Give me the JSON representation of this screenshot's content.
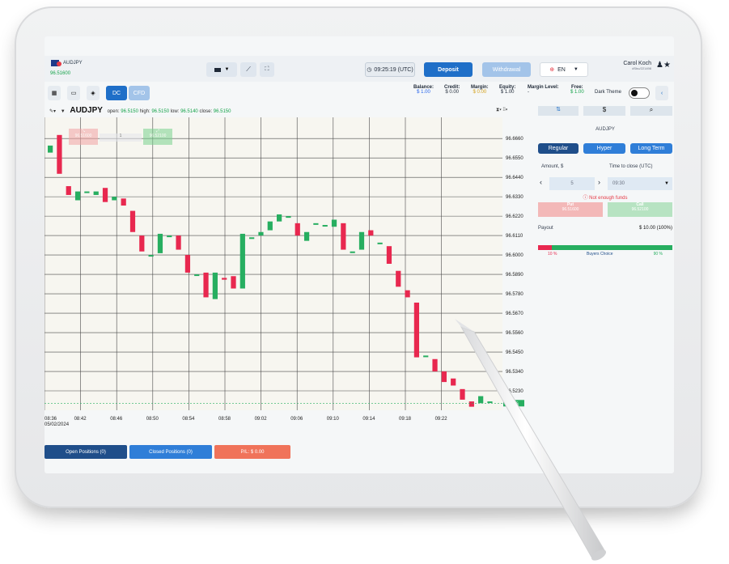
{
  "header": {
    "pair": "AUDJPY",
    "price": "96.51600",
    "time": "09:25:19 (UTC)",
    "deposit_label": "Deposit",
    "withdrawal_label": "Withdrawal",
    "language": "EN",
    "user_name": "Carol Koch",
    "user_id": "#Sbu/221498"
  },
  "toolbar": {
    "dc_label": "DC",
    "cfd_label": "CFD",
    "dark_theme_label": "Dark Theme"
  },
  "account": {
    "balance_label": "Balance:",
    "balance_value": "$ 1.00",
    "credit_label": "Credit:",
    "credit_value": "$ 0.00",
    "margin_label": "Margin:",
    "margin_value": "$ 0.00",
    "equity_label": "Equity:",
    "equity_value": "$ 1.00",
    "margin_level_label": "Margin Level:",
    "margin_level_value": "-",
    "free_label": "Free:",
    "free_value": "$ 1.00"
  },
  "chart_header": {
    "pair": "AUDJPY",
    "open_label": "open:",
    "open": "96.5150",
    "high_label": "high:",
    "high": "96.5150",
    "low_label": "low:",
    "low": "96.5140",
    "close_label": "close:",
    "close": "96.5150"
  },
  "chart_overlay": {
    "sell_price": "96.51600",
    "buy_price": "96.52100",
    "qty": "1"
  },
  "panel": {
    "tab_icons": [
      "arrows-icon",
      "dollar-icon",
      "chat-icon"
    ],
    "dollar_label": "$",
    "pair": "AUDJPY",
    "modes": [
      "Regular",
      "Hyper",
      "Long Term"
    ],
    "amount_label": "Amount, $",
    "time_label": "Time to close (UTC)",
    "amount_value": "5",
    "time_value": "09:30",
    "warning": "Not enough funds",
    "put_label": "Put",
    "put_price": "96.51600",
    "call_label": "Call",
    "call_price": "96.52100",
    "payout_label": "Payout",
    "payout_value": "$ 10.00 (100%)",
    "sentiment_left": "10 %",
    "sentiment_mid": "Buyers Choice",
    "sentiment_right": "90 %",
    "sentiment_fraction": 0.1
  },
  "bottom": {
    "open_positions": "Open Positions  (0)",
    "closed_positions": "Closed Positions  (0)",
    "pl": "P/L:  $ 0.00"
  },
  "chart_data": {
    "type": "candlestick",
    "x_ticks": [
      "08:36\n05/02/2024",
      "08:42",
      "08:46",
      "08:50",
      "08:54",
      "08:58",
      "09:02",
      "09:06",
      "09:10",
      "09:14",
      "09:18",
      "09:22"
    ],
    "y_ticks": [
      "96.6660",
      "96.6550",
      "96.6440",
      "96.6330",
      "96.6220",
      "96.6110",
      "96.6000",
      "96.5890",
      "96.5780",
      "96.5670",
      "96.5560",
      "96.5450",
      "96.5340",
      "96.5230"
    ],
    "ylim": [
      96.512,
      96.678
    ],
    "last_price": "96.516",
    "colors": {
      "up": "#27ae60",
      "down": "#e8284f"
    },
    "candles": [
      {
        "o": 96.658,
        "c": 96.662
      },
      {
        "o": 96.668,
        "c": 96.646
      },
      {
        "o": 96.639,
        "c": 96.634
      },
      {
        "o": 96.631,
        "c": 96.636
      },
      {
        "o": 96.636,
        "c": 96.636
      },
      {
        "o": 96.634,
        "c": 96.636
      },
      {
        "o": 96.638,
        "c": 96.63
      },
      {
        "o": 96.631,
        "c": 96.633
      },
      {
        "o": 96.632,
        "c": 96.628
      },
      {
        "o": 96.625,
        "c": 96.613
      },
      {
        "o": 96.611,
        "c": 96.602
      },
      {
        "o": 96.6,
        "c": 96.6
      },
      {
        "o": 96.601,
        "c": 96.612
      },
      {
        "o": 96.611,
        "c": 96.611
      },
      {
        "o": 96.611,
        "c": 96.603
      },
      {
        "o": 96.6,
        "c": 96.59
      },
      {
        "o": 96.589,
        "c": 96.589
      },
      {
        "o": 96.59,
        "c": 96.576
      },
      {
        "o": 96.575,
        "c": 96.59
      },
      {
        "o": 96.587,
        "c": 96.586
      },
      {
        "o": 96.588,
        "c": 96.581
      },
      {
        "o": 96.581,
        "c": 96.612
      },
      {
        "o": 96.61,
        "c": 96.61
      },
      {
        "o": 96.611,
        "c": 96.613
      },
      {
        "o": 96.614,
        "c": 96.619
      },
      {
        "o": 96.619,
        "c": 96.623
      },
      {
        "o": 96.622,
        "c": 96.622
      },
      {
        "o": 96.618,
        "c": 96.611
      },
      {
        "o": 96.608,
        "c": 96.613
      },
      {
        "o": 96.618,
        "c": 96.618
      },
      {
        "o": 96.617,
        "c": 96.617
      },
      {
        "o": 96.616,
        "c": 96.62
      },
      {
        "o": 96.618,
        "c": 96.603
      },
      {
        "o": 96.602,
        "c": 96.602
      },
      {
        "o": 96.603,
        "c": 96.613
      },
      {
        "o": 96.614,
        "c": 96.611
      },
      {
        "o": 96.607,
        "c": 96.607
      },
      {
        "o": 96.605,
        "c": 96.595
      },
      {
        "o": 96.591,
        "c": 96.582
      },
      {
        "o": 96.58,
        "c": 96.576
      },
      {
        "o": 96.573,
        "c": 96.542
      },
      {
        "o": 96.543,
        "c": 96.543
      },
      {
        "o": 96.541,
        "c": 96.534
      },
      {
        "o": 96.534,
        "c": 96.528
      },
      {
        "o": 96.53,
        "c": 96.526
      },
      {
        "o": 96.524,
        "c": 96.518
      },
      {
        "o": 96.517,
        "c": 96.514
      },
      {
        "o": 96.516,
        "c": 96.52
      },
      {
        "o": 96.517,
        "c": 96.517
      }
    ]
  }
}
